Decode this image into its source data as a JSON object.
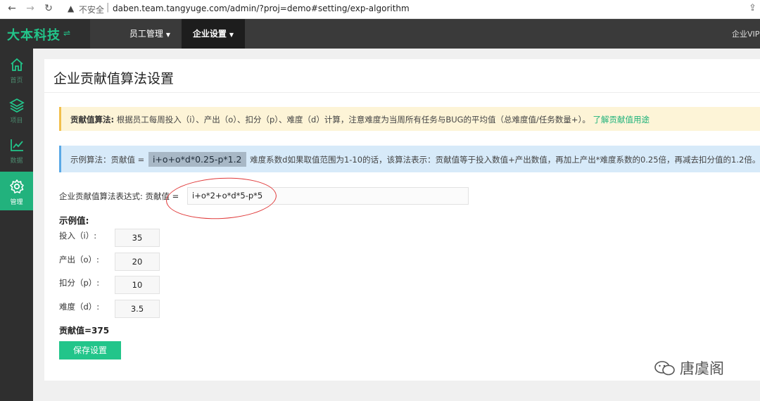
{
  "browser": {
    "insecure_label": "不安全",
    "url": "daben.team.tangyuge.com/admin/?proj=demo#setting/exp-algorithm"
  },
  "brand": {
    "name": "大本科技",
    "switch_glyph": "⇌"
  },
  "topnav": [
    {
      "label": "员工管理"
    },
    {
      "label": "企业设置"
    }
  ],
  "topbar_right": "企业VIP至",
  "sidebar": [
    {
      "label": "首页",
      "icon": "home-icon"
    },
    {
      "label": "项目",
      "icon": "layers-icon"
    },
    {
      "label": "数据",
      "icon": "chart-icon"
    },
    {
      "label": "管理",
      "icon": "gear-icon"
    }
  ],
  "page": {
    "title": "企业贡献值算法设置",
    "algo_note_title": "贡献值算法:",
    "algo_note_text": "根据员工每周投入（i）、产出（o）、扣分（p）、难度（d）计算，注意难度为当周所有任务与BUG的平均值（总难度值/任务数量+）。",
    "algo_note_link": "了解贡献值用途",
    "example_prefix": "示例算法：贡献值 =",
    "example_formula": "i+o+o*d*0.25-p*1.2",
    "example_desc": "难度系数d如果取值范围为1-10的话，该算法表示：贡献值等于投入数值+产出数值，再加上产出*难度系数的0.25倍，再减去扣分值的1.2倍。",
    "expr_label": "企业贡献值算法表达式:  贡献值 =",
    "expr_value": "i+o*2+o*d*5-p*5",
    "sample_title": "示例值:",
    "fields": [
      {
        "label": "投入（i）:",
        "value": "35"
      },
      {
        "label": "产出（o）:",
        "value": "20"
      },
      {
        "label": "扣分（p）:",
        "value": "10"
      },
      {
        "label": "难度（d）:",
        "value": "3.5"
      }
    ],
    "result": "贡献值=375",
    "save_label": "保存设置"
  },
  "watermark": "唐虞阁",
  "colors": {
    "accent": "#22c58a",
    "topbar": "#3a3a3a",
    "sidebar": "#2f2f2f",
    "annotation_circle": "#e03a3a"
  }
}
